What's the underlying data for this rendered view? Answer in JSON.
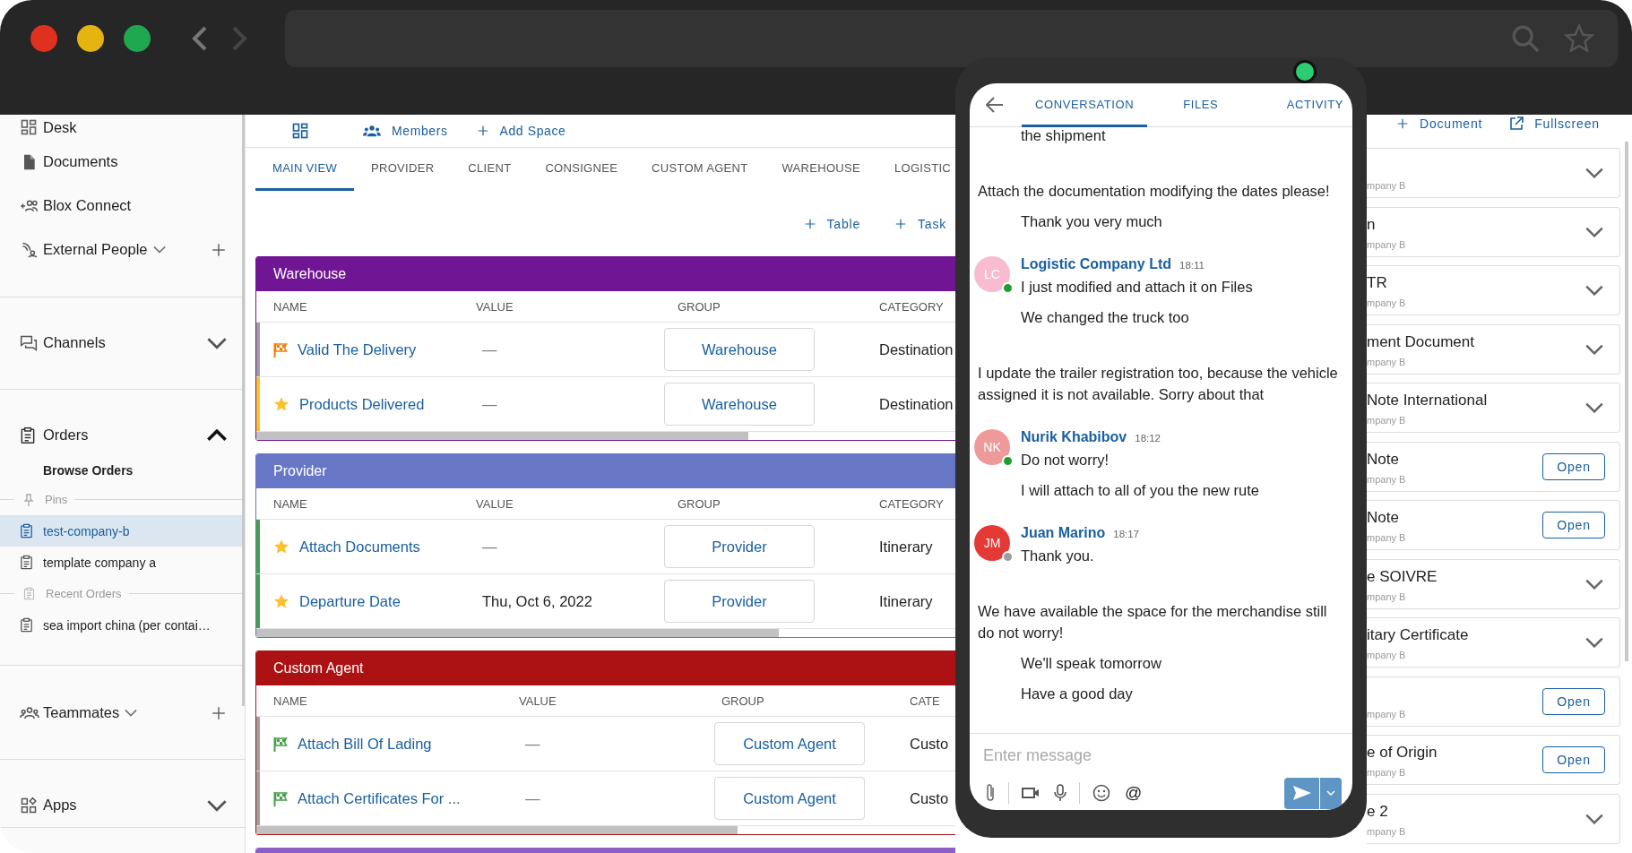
{
  "sidebar": {
    "sections": [
      {
        "items": [
          {
            "kind": "link",
            "label": "Desk"
          },
          {
            "kind": "link",
            "label": "Documents"
          },
          {
            "kind": "link",
            "label": "Blox Connect"
          },
          {
            "kind": "addable",
            "label": "External People",
            "expanded": false
          }
        ]
      },
      {
        "items": [
          {
            "kind": "group",
            "label": "Channels",
            "expanded": false
          }
        ]
      },
      {
        "items": [
          {
            "kind": "group",
            "label": "Orders",
            "expanded": true,
            "children": [
              {
                "kind": "link",
                "label": "Browse Orders"
              },
              {
                "kind": "pins",
                "label": "Pins"
              },
              {
                "kind": "order",
                "label": "test-company-b",
                "selected": true
              },
              {
                "kind": "order",
                "label": "template company a",
                "selected": false
              },
              {
                "kind": "recent",
                "label": "Recent Orders"
              },
              {
                "kind": "order",
                "label": "sea import china (per contai…",
                "selected": false
              }
            ]
          }
        ]
      },
      {
        "items": [
          {
            "kind": "addable",
            "label": "Teammates",
            "expanded": false
          }
        ]
      },
      {
        "items": [
          {
            "kind": "group",
            "label": "Apps",
            "expanded": false
          }
        ]
      }
    ]
  },
  "main": {
    "toolbar": {
      "members": "Members",
      "add_space": "Add Space"
    },
    "tabs": [
      {
        "label": "MAIN VIEW",
        "selected": true
      },
      {
        "label": "PROVIDER",
        "selected": false
      },
      {
        "label": "CLIENT",
        "selected": false
      },
      {
        "label": "CONSIGNEE",
        "selected": false
      },
      {
        "label": "CUSTOM AGENT",
        "selected": false
      },
      {
        "label": "WAREHOUSE",
        "selected": false
      },
      {
        "label": "LOGISTIC",
        "selected": false
      }
    ],
    "actions": [
      "Table",
      "Task"
    ],
    "tables": [
      {
        "title": "Warehouse",
        "color": "#701593",
        "columns": [
          "NAME",
          "VALUE",
          "GROUP",
          "CATEGORY"
        ],
        "rows": [
          {
            "name": "Valid The Delivery",
            "kind": "started",
            "color": "#9e9e9e",
            "value": "—",
            "group": "Warehouse",
            "category": "Destination"
          },
          {
            "name": "Products Delivered",
            "kind": "starred",
            "color": "#fbc02d",
            "value": "—",
            "group": "Warehouse",
            "category": "Destination"
          }
        ]
      },
      {
        "title": "Provider",
        "color": "#6777c6",
        "columns": [
          "NAME",
          "VALUE",
          "GROUP",
          "CATEGORY"
        ],
        "rows": [
          {
            "name": "Attach Documents",
            "kind": "starred",
            "color": "#43a047",
            "value": "—",
            "group": "Provider",
            "category": "Itinerary"
          },
          {
            "name": "Departure Date",
            "kind": "starred",
            "color": "#43a047",
            "value": "Thu, Oct 6, 2022",
            "group": "Provider",
            "category": "Itinerary"
          }
        ]
      },
      {
        "title": "Custom Agent",
        "color": "#ac1214",
        "columns": [
          "NAME",
          "VALUE",
          "GROUP",
          "CATE"
        ],
        "rows": [
          {
            "name": "Attach Bill Of Lading",
            "kind": "finished",
            "color": "#9e9e9e",
            "value": "—",
            "group": "Custom Agent",
            "category": "Custo"
          },
          {
            "name": "Attach Certificates For ...",
            "kind": "finished",
            "color": "#9e9e9e",
            "value": "—",
            "group": "Custom Agent",
            "category": "Custo"
          }
        ]
      },
      {
        "color": "#8a5fc6"
      }
    ]
  },
  "chat": {
    "tabs": [
      {
        "label": "CONVERSATION",
        "selected": true
      },
      {
        "label": "FILES",
        "selected": false
      },
      {
        "label": "ACTIVITY",
        "selected": false
      }
    ],
    "messages": [
      {
        "kind": "continuation",
        "text": "the shipment"
      },
      {
        "kind": "standalone",
        "text": "Attach the documentation modifying the dates please!"
      },
      {
        "kind": "continuation",
        "text": "Thank you very much"
      },
      {
        "kind": "authored",
        "initials": "LC",
        "author": "Logistic Company Ltd",
        "time": "18:11",
        "online": true,
        "color": "#f8bbd0",
        "text": "I just modified and attach it on Files"
      },
      {
        "kind": "continuation",
        "text": "We changed the truck too"
      },
      {
        "kind": "standalone",
        "text": "I update the trailer registration too, because the vehicle assigned it is not available. Sorry about that"
      },
      {
        "kind": "authored",
        "initials": "NK",
        "author": "Nurik Khabibov",
        "time": "18:12",
        "online": true,
        "color": "#ef9a9a",
        "text": "Do not worry!"
      },
      {
        "kind": "continuation",
        "text": "I will attach to all of you the new rute"
      },
      {
        "kind": "authored",
        "initials": "JM",
        "author": "Juan Marino",
        "time": "18:17",
        "online": false,
        "color": "#e53935",
        "text": "Thank you."
      },
      {
        "kind": "standalone",
        "text": "We have available the space for the merchandise still do not worry!"
      },
      {
        "kind": "continuation",
        "text": "We'll speak tomorrow"
      },
      {
        "kind": "continuation",
        "text": "Have a good day"
      }
    ],
    "composer": {
      "placeholder": "Enter message",
      "mention": "@"
    }
  },
  "documents": {
    "actions": [
      "Document",
      "Fullscreen"
    ],
    "items": [
      {
        "subtitle": "mpany B",
        "kind": "expand"
      },
      {
        "title": "n",
        "subtitle": "mpany B",
        "kind": "expand"
      },
      {
        "title": "TR",
        "subtitle": "mpany B",
        "kind": "expand"
      },
      {
        "title": "ment Document",
        "subtitle": "mpany B",
        "kind": "expand"
      },
      {
        "title": "Note International",
        "subtitle": "mpany B",
        "kind": "expand"
      },
      {
        "title": "Note",
        "subtitle": "mpany B",
        "kind": "open",
        "button": "Open"
      },
      {
        "title": "Note",
        "subtitle": "mpany B",
        "kind": "open",
        "button": "Open"
      },
      {
        "title": "e SOIVRE",
        "subtitle": "mpany B",
        "kind": "expand"
      },
      {
        "title": "itary Certificate",
        "subtitle": "mpany B",
        "kind": "expand"
      },
      {
        "subtitle": "mpany B",
        "kind": "open",
        "button": "Open"
      },
      {
        "title": "e of Origin",
        "subtitle": "mpany B",
        "kind": "open",
        "button": "Open"
      },
      {
        "title": "e 2",
        "subtitle": "mpany B",
        "kind": "expand"
      }
    ]
  }
}
